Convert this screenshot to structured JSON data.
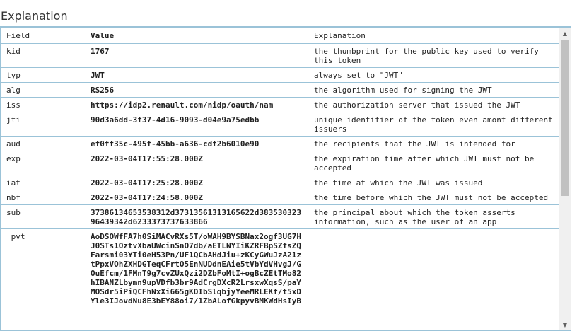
{
  "section": {
    "title": "Explanation"
  },
  "table": {
    "headers": {
      "field": "Field",
      "value": "Value",
      "explanation": "Explanation"
    },
    "rows": [
      {
        "field": "kid",
        "value": "1767",
        "explanation": "the thumbprint for the public key used to verify this token"
      },
      {
        "field": "typ",
        "value": "JWT",
        "explanation": "always set to \"JWT\""
      },
      {
        "field": "alg",
        "value": "RS256",
        "explanation": "the algorithm used for signing the JWT"
      },
      {
        "field": "iss",
        "value": "https://idp2.renault.com/nidp/oauth/nam",
        "explanation": "the authorization server that issued the JWT"
      },
      {
        "field": "jti",
        "value": "90d3a6dd-3f37-4d16-9093-d04e9a75edbb",
        "explanation": "unique identifier of the token even amont different issuers"
      },
      {
        "field": "aud",
        "value": "ef0ff35c-495f-45bb-a636-cdf2b6010e90",
        "explanation": "the recipients that the JWT is intended for"
      },
      {
        "field": "exp",
        "value": "2022-03-04T17:55:28.000Z",
        "explanation": "the expiration time after which JWT must not be accepted"
      },
      {
        "field": "iat",
        "value": "2022-03-04T17:25:28.000Z",
        "explanation": "the time at which the JWT was issued"
      },
      {
        "field": "nbf",
        "value": "2022-03-04T17:24:58.000Z",
        "explanation": "the time before which the JWT must not be accepted"
      },
      {
        "field": "sub",
        "value": "37386134653538312d37313561313165622d38353032396439342d6233373737633866",
        "explanation": "the principal about which the token asserts information, such as the user of an app"
      },
      {
        "field": "_pvt",
        "value": "AoDSOWfFA7h0SiMACvRXs5T/oWAH9BYSBNax2ogf3UG7HJ0STs1OztvXbaUWcinSnO7db/aETLNYIiKZRFBpSZfsZQFarsmi03YTi0eH53Pn/UF1QCbAHdJiu+zKCyGWuJzA21ztPpxVOhZXHDGTeqCFrtO5EnNUDdnEAie5tVbYdVHvgJ/GOuEfcm/1FMnT9g7cvZUxQzi2DZbFoMtI+ogBcZEtTMo82hIBANZLbymn9upVDfb3br9AdCrgDXcR2LrsxwXqsS/paYMOSdr5iPiQCFhNxXi665gKDIbSlqbjyYeeMRLEKf/t5xDYle3IJovdNu8E3bEY88oi7/1ZbALofGkpyvBMKWdHsIyB",
        "explanation": ""
      }
    ]
  }
}
